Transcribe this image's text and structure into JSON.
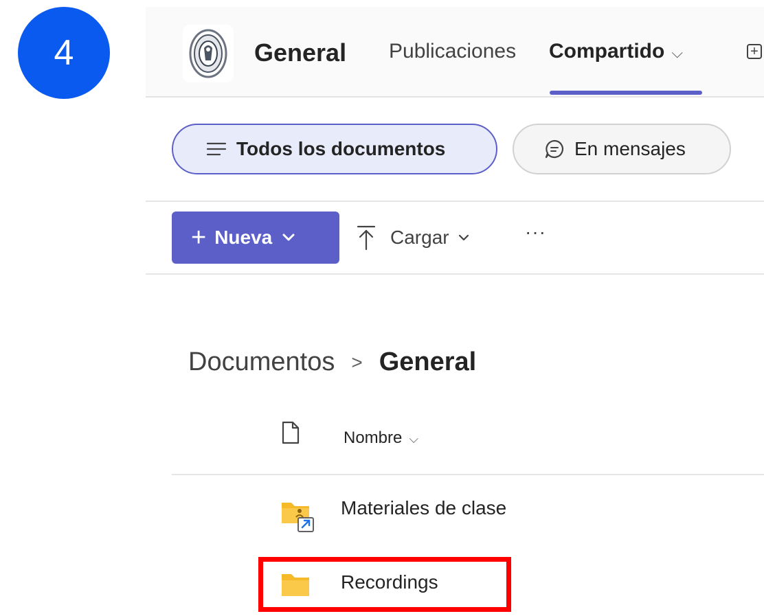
{
  "step": {
    "number": "4"
  },
  "header": {
    "channel_name": "General",
    "tabs": [
      {
        "label": "Publicaciones",
        "selected": false
      },
      {
        "label": "Compartido",
        "selected": true
      }
    ],
    "add_tab_icon": "plus-square-icon"
  },
  "filters": {
    "all_documents": "Todos los documentos",
    "in_messages": "En mensajes"
  },
  "toolbar": {
    "new_label": "Nueva",
    "upload_label": "Cargar",
    "more_label": "···"
  },
  "breadcrumb": {
    "root": "Documentos",
    "current": "General"
  },
  "file_list": {
    "name_column": "Nombre",
    "rows": [
      {
        "name": "Materiales de clase",
        "icon": "shared-folder-icon"
      },
      {
        "name": "Recordings",
        "icon": "folder-icon"
      }
    ]
  },
  "colors": {
    "accent": "#5b5fc7",
    "step_badge": "#0a5af0",
    "highlight": "#ff0000",
    "folder": "#f5b92a"
  }
}
